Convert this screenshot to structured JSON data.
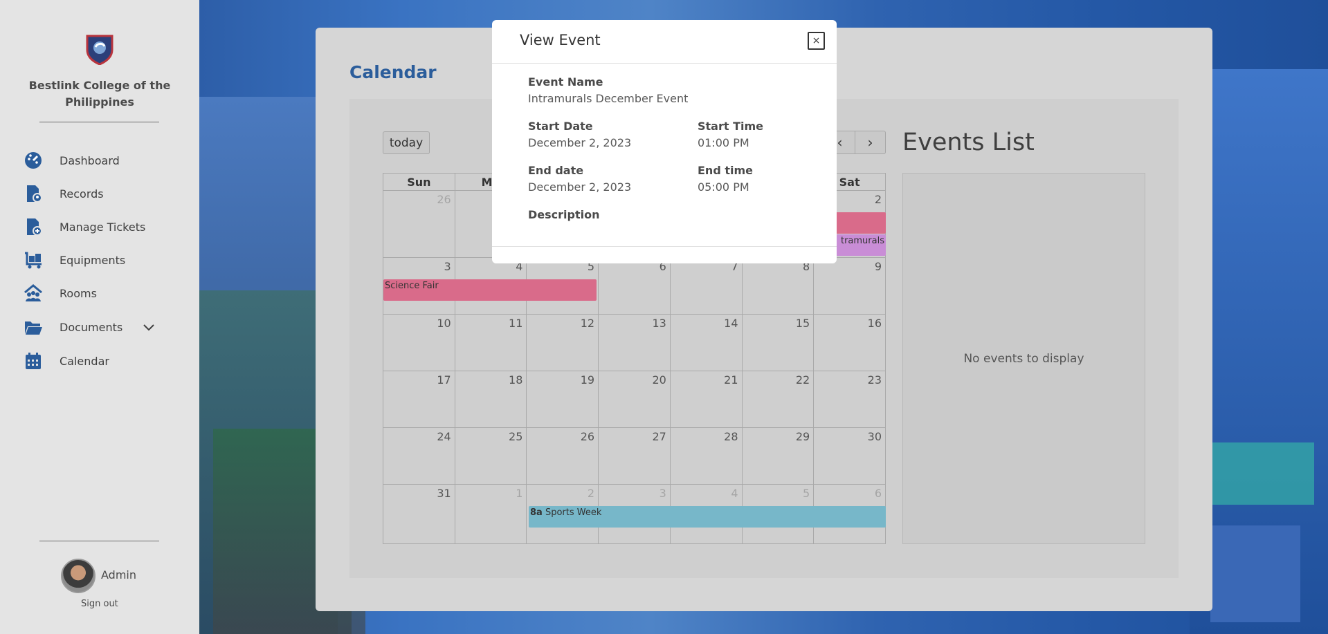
{
  "sidebar": {
    "school_name": "Bestlink College of the Philippines",
    "items": [
      {
        "label": "Dashboard",
        "icon": "dashboard-icon"
      },
      {
        "label": "Records",
        "icon": "records-icon"
      },
      {
        "label": "Manage Tickets",
        "icon": "ticket-icon"
      },
      {
        "label": "Equipments",
        "icon": "equipment-icon"
      },
      {
        "label": "Rooms",
        "icon": "rooms-icon"
      },
      {
        "label": "Documents",
        "icon": "folder-icon"
      },
      {
        "label": "Calendar",
        "icon": "calendar-icon"
      }
    ],
    "user": {
      "name": "Admin",
      "signout": "Sign out"
    }
  },
  "page": {
    "title": "Calendar"
  },
  "calendar": {
    "today_label": "today",
    "prev_symbol": "‹",
    "next_symbol": "›",
    "days": [
      "Sun",
      "Mo",
      "",
      "",
      "",
      "",
      "Sat"
    ],
    "weeks": [
      [
        "26",
        "",
        "",
        "",
        "",
        "",
        "2"
      ],
      [
        "3",
        "4",
        "5",
        "6",
        "7",
        "8",
        "9"
      ],
      [
        "10",
        "11",
        "12",
        "13",
        "14",
        "15",
        "16"
      ],
      [
        "17",
        "18",
        "19",
        "20",
        "21",
        "22",
        "23"
      ],
      [
        "24",
        "25",
        "26",
        "27",
        "28",
        "29",
        "30"
      ],
      [
        "31",
        "1",
        "2",
        "3",
        "4",
        "5",
        "6"
      ]
    ],
    "events": [
      {
        "title": "Science Fair",
        "time": "",
        "color": "#d96b8a"
      },
      {
        "title": "tramurals",
        "time": "",
        "color": "#c98dd6"
      },
      {
        "title": "Sports Week",
        "time": "8a",
        "color": "#77b7c9"
      }
    ],
    "event_colors": {
      "pink_bar": "#d96b8a"
    }
  },
  "events_list": {
    "title": "Events List",
    "empty_text": "No events to display"
  },
  "modal": {
    "title": "View Event",
    "close": "×",
    "event_name_label": "Event Name",
    "event_name": "Intramurals December Event",
    "start_date_label": "Start Date",
    "start_date": "December 2, 2023",
    "start_time_label": "Start Time",
    "start_time": "01:00 PM",
    "end_date_label": "End date",
    "end_date": "December 2, 2023",
    "end_time_label": "End time",
    "end_time": "05:00 PM",
    "description_label": "Description"
  }
}
